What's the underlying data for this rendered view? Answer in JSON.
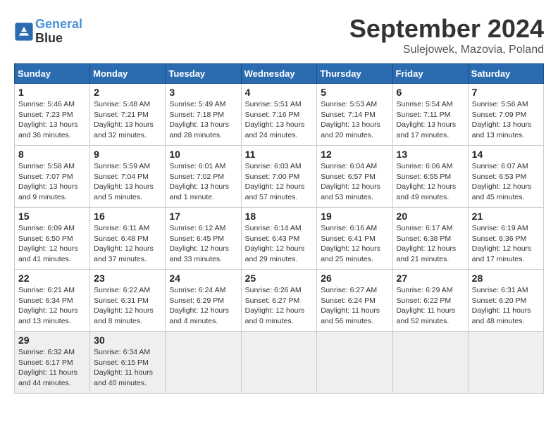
{
  "header": {
    "logo_line1": "General",
    "logo_line2": "Blue",
    "month": "September 2024",
    "location": "Sulejowek, Mazovia, Poland"
  },
  "days_of_week": [
    "Sunday",
    "Monday",
    "Tuesday",
    "Wednesday",
    "Thursday",
    "Friday",
    "Saturday"
  ],
  "weeks": [
    [
      {
        "day": "1",
        "sunrise": "5:46 AM",
        "sunset": "7:23 PM",
        "daylight": "13 hours and 36 minutes."
      },
      {
        "day": "2",
        "sunrise": "5:48 AM",
        "sunset": "7:21 PM",
        "daylight": "13 hours and 32 minutes."
      },
      {
        "day": "3",
        "sunrise": "5:49 AM",
        "sunset": "7:18 PM",
        "daylight": "13 hours and 28 minutes."
      },
      {
        "day": "4",
        "sunrise": "5:51 AM",
        "sunset": "7:16 PM",
        "daylight": "13 hours and 24 minutes."
      },
      {
        "day": "5",
        "sunrise": "5:53 AM",
        "sunset": "7:14 PM",
        "daylight": "13 hours and 20 minutes."
      },
      {
        "day": "6",
        "sunrise": "5:54 AM",
        "sunset": "7:11 PM",
        "daylight": "13 hours and 17 minutes."
      },
      {
        "day": "7",
        "sunrise": "5:56 AM",
        "sunset": "7:09 PM",
        "daylight": "13 hours and 13 minutes."
      }
    ],
    [
      {
        "day": "8",
        "sunrise": "5:58 AM",
        "sunset": "7:07 PM",
        "daylight": "13 hours and 9 minutes."
      },
      {
        "day": "9",
        "sunrise": "5:59 AM",
        "sunset": "7:04 PM",
        "daylight": "13 hours and 5 minutes."
      },
      {
        "day": "10",
        "sunrise": "6:01 AM",
        "sunset": "7:02 PM",
        "daylight": "13 hours and 1 minute."
      },
      {
        "day": "11",
        "sunrise": "6:03 AM",
        "sunset": "7:00 PM",
        "daylight": "12 hours and 57 minutes."
      },
      {
        "day": "12",
        "sunrise": "6:04 AM",
        "sunset": "6:57 PM",
        "daylight": "12 hours and 53 minutes."
      },
      {
        "day": "13",
        "sunrise": "6:06 AM",
        "sunset": "6:55 PM",
        "daylight": "12 hours and 49 minutes."
      },
      {
        "day": "14",
        "sunrise": "6:07 AM",
        "sunset": "6:53 PM",
        "daylight": "12 hours and 45 minutes."
      }
    ],
    [
      {
        "day": "15",
        "sunrise": "6:09 AM",
        "sunset": "6:50 PM",
        "daylight": "12 hours and 41 minutes."
      },
      {
        "day": "16",
        "sunrise": "6:11 AM",
        "sunset": "6:48 PM",
        "daylight": "12 hours and 37 minutes."
      },
      {
        "day": "17",
        "sunrise": "6:12 AM",
        "sunset": "6:45 PM",
        "daylight": "12 hours and 33 minutes."
      },
      {
        "day": "18",
        "sunrise": "6:14 AM",
        "sunset": "6:43 PM",
        "daylight": "12 hours and 29 minutes."
      },
      {
        "day": "19",
        "sunrise": "6:16 AM",
        "sunset": "6:41 PM",
        "daylight": "12 hours and 25 minutes."
      },
      {
        "day": "20",
        "sunrise": "6:17 AM",
        "sunset": "6:38 PM",
        "daylight": "12 hours and 21 minutes."
      },
      {
        "day": "21",
        "sunrise": "6:19 AM",
        "sunset": "6:36 PM",
        "daylight": "12 hours and 17 minutes."
      }
    ],
    [
      {
        "day": "22",
        "sunrise": "6:21 AM",
        "sunset": "6:34 PM",
        "daylight": "12 hours and 13 minutes."
      },
      {
        "day": "23",
        "sunrise": "6:22 AM",
        "sunset": "6:31 PM",
        "daylight": "12 hours and 8 minutes."
      },
      {
        "day": "24",
        "sunrise": "6:24 AM",
        "sunset": "6:29 PM",
        "daylight": "12 hours and 4 minutes."
      },
      {
        "day": "25",
        "sunrise": "6:26 AM",
        "sunset": "6:27 PM",
        "daylight": "12 hours and 0 minutes."
      },
      {
        "day": "26",
        "sunrise": "6:27 AM",
        "sunset": "6:24 PM",
        "daylight": "11 hours and 56 minutes."
      },
      {
        "day": "27",
        "sunrise": "6:29 AM",
        "sunset": "6:22 PM",
        "daylight": "11 hours and 52 minutes."
      },
      {
        "day": "28",
        "sunrise": "6:31 AM",
        "sunset": "6:20 PM",
        "daylight": "11 hours and 48 minutes."
      }
    ],
    [
      {
        "day": "29",
        "sunrise": "6:32 AM",
        "sunset": "6:17 PM",
        "daylight": "11 hours and 44 minutes."
      },
      {
        "day": "30",
        "sunrise": "6:34 AM",
        "sunset": "6:15 PM",
        "daylight": "11 hours and 40 minutes."
      },
      null,
      null,
      null,
      null,
      null
    ]
  ]
}
